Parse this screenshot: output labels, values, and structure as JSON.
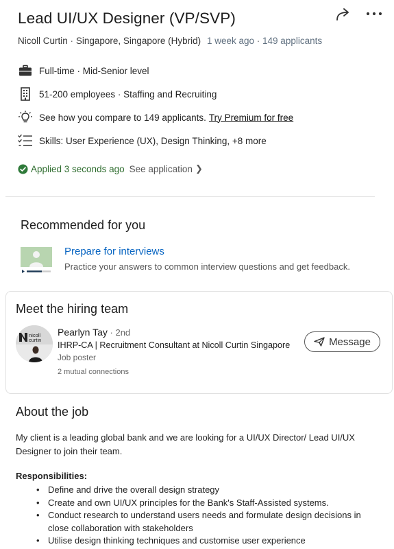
{
  "job": {
    "title": "Lead UI/UX Designer (VP/SVP)",
    "company": "Nicoll Curtin",
    "location": "Singapore, Singapore (Hybrid)",
    "posted": "1 week ago",
    "applicants": "149 applicants",
    "sep": "·"
  },
  "insights": {
    "type": "Full-time · Mid-Senior level",
    "company_size": "51-200 employees · Staffing and Recruiting",
    "compare": "See how you compare to 149 applicants.",
    "premium_link": "Try Premium for free",
    "skills": "Skills: User Experience (UX), Design Thinking, +8 more"
  },
  "application": {
    "status": "Applied 3 seconds ago",
    "see_application": "See application",
    "chevron": "❯",
    "status_color": "#2f7a3a"
  },
  "recommended": {
    "title": "Recommended for you",
    "link": "Prepare for interviews",
    "description": "Practice your answers to common interview questions and get feedback."
  },
  "hiring_team": {
    "title": "Meet the hiring team",
    "name": "Pearlyn Tay",
    "degree": " · 2nd",
    "headline": "IHRP-CA | Recruitment Consultant at Nicoll Curtin Singapore",
    "role": "Job poster",
    "mutual": "2 mutual connections",
    "message_label": "Message",
    "logo_text_top": "nicoll",
    "logo_text_bottom": "curtin"
  },
  "about": {
    "title": "About the job",
    "intro": "My client is a leading global bank and we are looking for a UI/UX Director/ Lead UI/UX Designer to join their team.",
    "responsibilities_title": "Responsibilities:",
    "responsibilities": [
      "Define and drive the overall design strategy",
      "Create and own UI/UX principles for the Bank's Staff-Assisted systems.",
      "Conduct research to understand users needs and formulate design decisions in close collaboration with stakeholders",
      "Utilise design thinking techniques and customise user experience"
    ]
  },
  "icons": {
    "share": "share-icon",
    "more": "more-icon",
    "briefcase": "briefcase-icon",
    "building": "building-icon",
    "lightbulb": "lightbulb-icon",
    "checklist": "checklist-icon",
    "check": "check-circle-icon",
    "send": "send-icon"
  },
  "colors": {
    "link_blue": "#0a66c2",
    "applied_green": "#2f7a3a"
  }
}
